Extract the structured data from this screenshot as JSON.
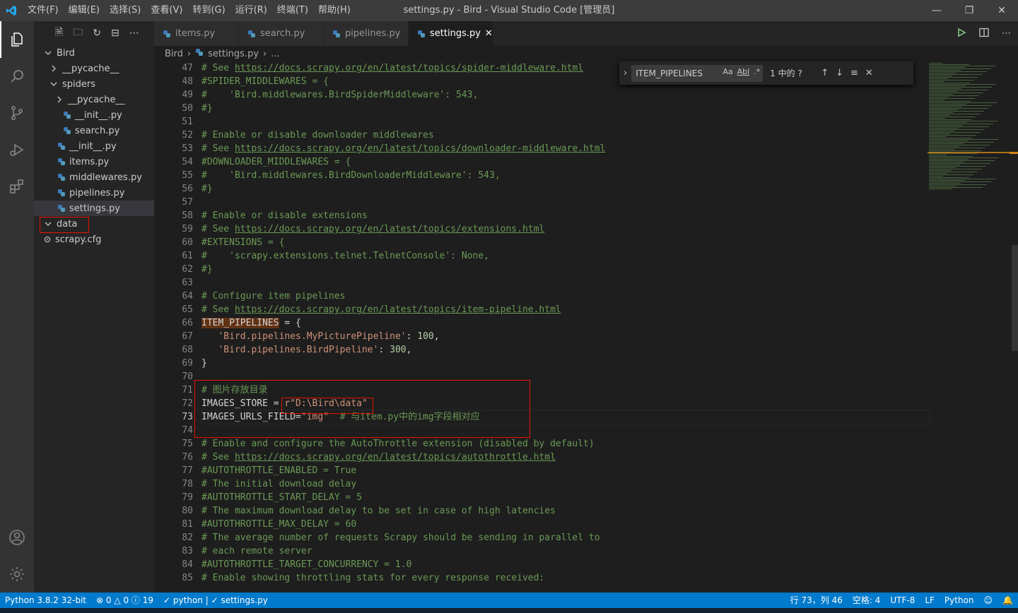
{
  "window": {
    "title": "settings.py - Bird - Visual Studio Code [管理员]",
    "menu": [
      "文件(F)",
      "编辑(E)",
      "选择(S)",
      "查看(V)",
      "转到(G)",
      "运行(R)",
      "终端(T)",
      "帮助(H)"
    ]
  },
  "explorer": {
    "items": [
      {
        "label": "Bird",
        "depth": 0,
        "kind": "folder-open"
      },
      {
        "label": "__pycache__",
        "depth": 1,
        "kind": "folder-closed"
      },
      {
        "label": "spiders",
        "depth": 1,
        "kind": "folder-open"
      },
      {
        "label": "__pycache__",
        "depth": 2,
        "kind": "folder-closed"
      },
      {
        "label": "__init__.py",
        "depth": 2,
        "kind": "py"
      },
      {
        "label": "search.py",
        "depth": 2,
        "kind": "py"
      },
      {
        "label": "__init__.py",
        "depth": 1,
        "kind": "py"
      },
      {
        "label": "items.py",
        "depth": 1,
        "kind": "py"
      },
      {
        "label": "middlewares.py",
        "depth": 1,
        "kind": "py"
      },
      {
        "label": "pipelines.py",
        "depth": 1,
        "kind": "py"
      },
      {
        "label": "settings.py",
        "depth": 1,
        "kind": "py",
        "selected": true
      },
      {
        "label": "data",
        "depth": 0,
        "kind": "folder-open"
      },
      {
        "label": "scrapy.cfg",
        "depth": 0,
        "kind": "cfg"
      }
    ]
  },
  "tabs": [
    {
      "label": "items.py",
      "active": false
    },
    {
      "label": "search.py",
      "active": false
    },
    {
      "label": "pipelines.py",
      "active": false
    },
    {
      "label": "settings.py",
      "active": true
    }
  ],
  "breadcrumb": {
    "root": "Bird",
    "file": "settings.py",
    "more": "..."
  },
  "find": {
    "query": "ITEM_PIPELINES",
    "opt_case": "Aa",
    "opt_word": "Abl",
    "opt_regex": ".*",
    "count": "1 中的 ?"
  },
  "editor": {
    "current_line": 73,
    "lines": [
      {
        "n": 47,
        "t": [
          [
            "c-com",
            "# See "
          ],
          [
            "c-link",
            "https://docs.scrapy.org/en/latest/topics/spider-middleware.html"
          ]
        ]
      },
      {
        "n": 48,
        "t": [
          [
            "c-com",
            "#SPIDER_MIDDLEWARES = {"
          ]
        ]
      },
      {
        "n": 49,
        "t": [
          [
            "c-com",
            "#    'Bird.middlewares.BirdSpiderMiddleware': 543,"
          ]
        ]
      },
      {
        "n": 50,
        "t": [
          [
            "c-com",
            "#}"
          ]
        ]
      },
      {
        "n": 51,
        "t": []
      },
      {
        "n": 52,
        "t": [
          [
            "c-com",
            "# Enable or disable downloader middlewares"
          ]
        ]
      },
      {
        "n": 53,
        "t": [
          [
            "c-com",
            "# See "
          ],
          [
            "c-link",
            "https://docs.scrapy.org/en/latest/topics/downloader-middleware.html"
          ]
        ]
      },
      {
        "n": 54,
        "t": [
          [
            "c-com",
            "#DOWNLOADER_MIDDLEWARES = {"
          ]
        ]
      },
      {
        "n": 55,
        "t": [
          [
            "c-com",
            "#    'Bird.middlewares.BirdDownloaderMiddleware': 543,"
          ]
        ]
      },
      {
        "n": 56,
        "t": [
          [
            "c-com",
            "#}"
          ]
        ]
      },
      {
        "n": 57,
        "t": []
      },
      {
        "n": 58,
        "t": [
          [
            "c-com",
            "# Enable or disable extensions"
          ]
        ]
      },
      {
        "n": 59,
        "t": [
          [
            "c-com",
            "# See "
          ],
          [
            "c-link",
            "https://docs.scrapy.org/en/latest/topics/extensions.html"
          ]
        ]
      },
      {
        "n": 60,
        "t": [
          [
            "c-com",
            "#EXTENSIONS = {"
          ]
        ]
      },
      {
        "n": 61,
        "t": [
          [
            "c-com",
            "#    'scrapy.extensions.telnet.TelnetConsole': None,"
          ]
        ]
      },
      {
        "n": 62,
        "t": [
          [
            "c-com",
            "#}"
          ]
        ]
      },
      {
        "n": 63,
        "t": []
      },
      {
        "n": 64,
        "t": [
          [
            "c-com",
            "# Configure item pipelines"
          ]
        ]
      },
      {
        "n": 65,
        "t": [
          [
            "c-com",
            "# See "
          ],
          [
            "c-link",
            "https://docs.scrapy.org/en/latest/topics/item-pipeline.html"
          ]
        ]
      },
      {
        "n": 66,
        "t": [
          [
            "c-var c-hl",
            "ITEM_PIPELINES"
          ],
          [
            "c-var",
            " = {"
          ]
        ]
      },
      {
        "n": 67,
        "t": [
          [
            "c-var",
            "   "
          ],
          [
            "c-str",
            "'Bird.pipelines.MyPicturePipeline'"
          ],
          [
            "c-var",
            ": "
          ],
          [
            "c-num",
            "100"
          ],
          [
            "c-var",
            ","
          ]
        ]
      },
      {
        "n": 68,
        "t": [
          [
            "c-var",
            "   "
          ],
          [
            "c-str",
            "'Bird.pipelines.BirdPipeline'"
          ],
          [
            "c-var",
            ": "
          ],
          [
            "c-num",
            "300"
          ],
          [
            "c-var",
            ","
          ]
        ]
      },
      {
        "n": 69,
        "t": [
          [
            "c-var",
            "}"
          ]
        ]
      },
      {
        "n": 70,
        "t": []
      },
      {
        "n": 71,
        "t": [
          [
            "c-com",
            "# 图片存放目录"
          ]
        ]
      },
      {
        "n": 72,
        "t": [
          [
            "c-var",
            "IMAGES_STORE = "
          ],
          [
            "c-str",
            "r\"D:\\Bird\\data\""
          ]
        ]
      },
      {
        "n": 73,
        "t": [
          [
            "c-var",
            "IMAGES_URLS_FIELD="
          ],
          [
            "c-str",
            "\"img\""
          ],
          [
            "c-var",
            "  "
          ],
          [
            "c-com",
            "# 与item.py中的img字段相对应"
          ]
        ]
      },
      {
        "n": 74,
        "t": []
      },
      {
        "n": 75,
        "t": [
          [
            "c-com",
            "# Enable and configure the AutoThrottle extension (disabled by default)"
          ]
        ]
      },
      {
        "n": 76,
        "t": [
          [
            "c-com",
            "# See "
          ],
          [
            "c-link",
            "https://docs.scrapy.org/en/latest/topics/autothrottle.html"
          ]
        ]
      },
      {
        "n": 77,
        "t": [
          [
            "c-com",
            "#AUTOTHROTTLE_ENABLED = True"
          ]
        ]
      },
      {
        "n": 78,
        "t": [
          [
            "c-com",
            "# The initial download delay"
          ]
        ]
      },
      {
        "n": 79,
        "t": [
          [
            "c-com",
            "#AUTOTHROTTLE_START_DELAY = 5"
          ]
        ]
      },
      {
        "n": 80,
        "t": [
          [
            "c-com",
            "# The maximum download delay to be set in case of high latencies"
          ]
        ]
      },
      {
        "n": 81,
        "t": [
          [
            "c-com",
            "#AUTOTHROTTLE_MAX_DELAY = 60"
          ]
        ]
      },
      {
        "n": 82,
        "t": [
          [
            "c-com",
            "# The average number of requests Scrapy should be sending in parallel to"
          ]
        ]
      },
      {
        "n": 83,
        "t": [
          [
            "c-com",
            "# each remote server"
          ]
        ]
      },
      {
        "n": 84,
        "t": [
          [
            "c-com",
            "#AUTOTHROTTLE_TARGET_CONCURRENCY = 1.0"
          ]
        ]
      },
      {
        "n": 85,
        "t": [
          [
            "c-com",
            "# Enable showing throttling stats for every response received:"
          ]
        ]
      }
    ]
  },
  "statusbar": {
    "interpreter": "Python 3.8.2 32-bit",
    "errors": "0",
    "warnings": "0",
    "info": "19",
    "check1": "python |",
    "check2": "settings.py",
    "position": "行 73，列 46",
    "spaces": "空格: 4",
    "encoding": "UTF-8",
    "eol": "LF",
    "language": "Python"
  },
  "colors": {
    "accent": "#007acc",
    "highlight_box": "#e51400",
    "comment": "#6a9955",
    "string": "#ce9178",
    "number": "#b5cea8"
  }
}
